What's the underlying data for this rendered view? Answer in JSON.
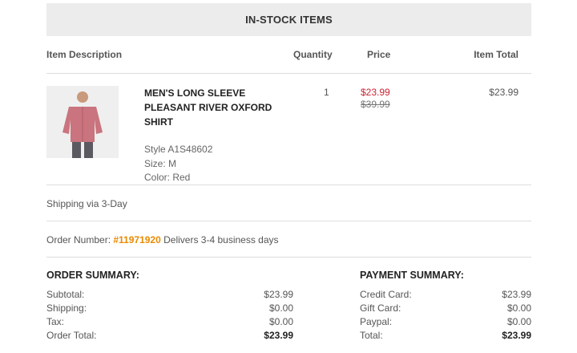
{
  "banner": {
    "title": "IN-STOCK ITEMS"
  },
  "columns": {
    "description": "Item Description",
    "quantity": "Quantity",
    "price": "Price",
    "item_total": "Item Total"
  },
  "item": {
    "title": "MEN'S LONG SLEEVE PLEASANT RIVER OXFORD SHIRT",
    "style": "Style A1S48602",
    "size": "Size: M",
    "color": "Color: Red",
    "quantity": "1",
    "sale_price": "$23.99",
    "original_price": "$39.99",
    "total": "$23.99"
  },
  "shipping": {
    "text": "Shipping via 3-Day"
  },
  "order": {
    "label": "Order Number:",
    "number": "#11971920",
    "delivery": "Delivers 3-4 business days"
  },
  "order_summary": {
    "heading": "ORDER SUMMARY:",
    "subtotal_label": "Subtotal:",
    "subtotal": "$23.99",
    "shipping_label": "Shipping:",
    "shipping": "$0.00",
    "tax_label": "Tax:",
    "tax": "$0.00",
    "total_label": "Order Total:",
    "total": "$23.99"
  },
  "payment_summary": {
    "heading": "PAYMENT SUMMARY:",
    "credit_label": "Credit Card:",
    "credit": "$23.99",
    "gift_label": "Gift Card:",
    "gift": "$0.00",
    "paypal_label": "Paypal:",
    "paypal": "$0.00",
    "total_label": "Total:",
    "total": "$23.99"
  }
}
